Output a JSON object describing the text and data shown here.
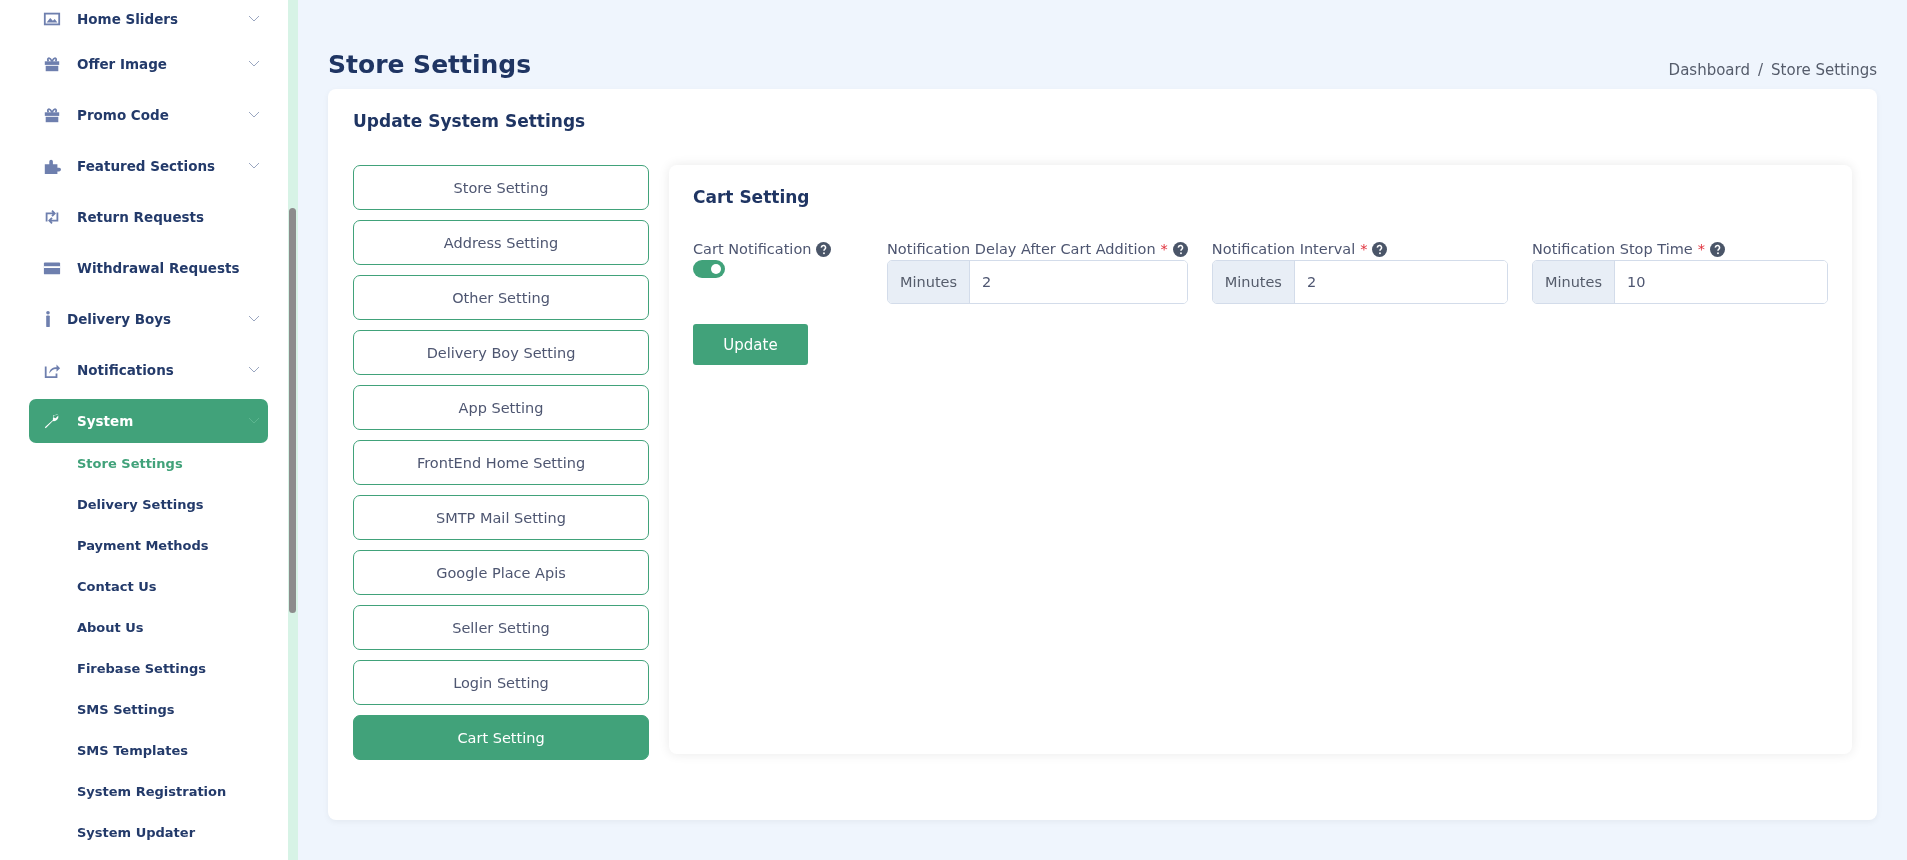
{
  "sidebar": {
    "items": [
      {
        "label": "Home Sliders",
        "expandable": true,
        "selected": false
      },
      {
        "label": "Offer Image",
        "expandable": true,
        "selected": false
      },
      {
        "label": "Promo Code",
        "expandable": true,
        "selected": false
      },
      {
        "label": "Featured Sections",
        "expandable": true,
        "selected": false
      },
      {
        "label": "Return Requests",
        "expandable": false,
        "selected": false
      },
      {
        "label": "Withdrawal Requests",
        "expandable": false,
        "selected": false
      },
      {
        "label": "Delivery Boys",
        "expandable": true,
        "selected": false
      },
      {
        "label": "Notifications",
        "expandable": true,
        "selected": false
      },
      {
        "label": "System",
        "expandable": true,
        "selected": true,
        "children": [
          {
            "label": "Store Settings",
            "selected": true
          },
          {
            "label": "Delivery Settings",
            "selected": false
          },
          {
            "label": "Payment Methods",
            "selected": false
          },
          {
            "label": "Contact Us",
            "selected": false
          },
          {
            "label": "About Us",
            "selected": false
          },
          {
            "label": "Firebase Settings",
            "selected": false
          },
          {
            "label": "SMS Settings",
            "selected": false
          },
          {
            "label": "SMS Templates",
            "selected": false
          },
          {
            "label": "System Registration",
            "selected": false
          },
          {
            "label": "System Updater",
            "selected": false
          }
        ]
      }
    ]
  },
  "page": {
    "title": "Store Settings",
    "breadcrumb": [
      "Dashboard",
      "/",
      "Store Settings"
    ]
  },
  "card": {
    "title": "Update System Settings",
    "tabs": [
      {
        "label": "Store Setting",
        "selected": false
      },
      {
        "label": "Address Setting",
        "selected": false
      },
      {
        "label": "Other Setting",
        "selected": false
      },
      {
        "label": "Delivery Boy Setting",
        "selected": false
      },
      {
        "label": "App Setting",
        "selected": false
      },
      {
        "label": "FrontEnd Home Setting",
        "selected": false
      },
      {
        "label": "SMTP Mail Setting",
        "selected": false
      },
      {
        "label": "Google Place Apis",
        "selected": false
      },
      {
        "label": "Seller Setting",
        "selected": false
      },
      {
        "label": "Login Setting",
        "selected": false
      },
      {
        "label": "Cart Setting",
        "selected": true
      }
    ],
    "panel": {
      "title": "Cart Setting",
      "fields": [
        {
          "kind": "toggle",
          "label": "Cart Notification",
          "on": true
        },
        {
          "kind": "input",
          "label": "Notification Delay After Cart Addition",
          "required_mark": "*",
          "prefix": "Minutes",
          "value": "2"
        },
        {
          "kind": "input",
          "label": "Notification Interval",
          "required_mark": "*",
          "prefix": "Minutes",
          "value": "2"
        },
        {
          "kind": "input",
          "label": "Notification Stop Time",
          "required_mark": "*",
          "prefix": "Minutes",
          "value": "10"
        }
      ],
      "button": "Update"
    }
  }
}
